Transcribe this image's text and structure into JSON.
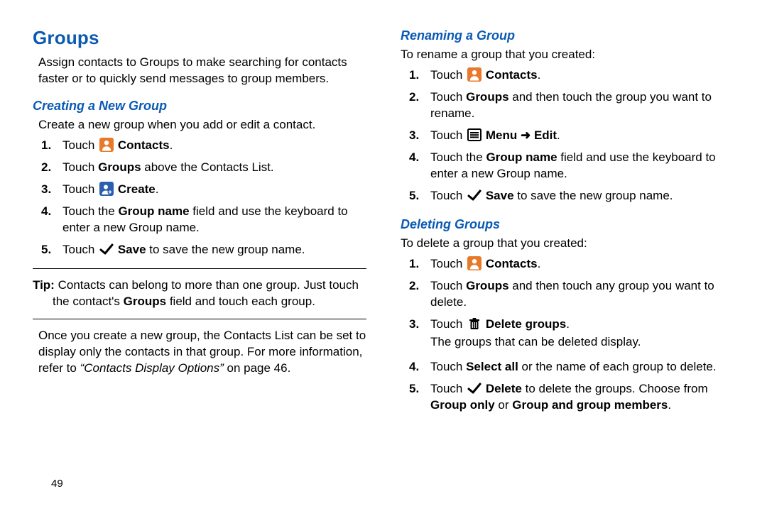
{
  "page_number": "49",
  "h1": "Groups",
  "intro": "Assign contacts to Groups to make searching for contacts faster or to quickly send messages to group members.",
  "creating": {
    "title": "Creating a New Group",
    "lead": "Create a new group when you add or edit a contact.",
    "s1_touch": "Touch",
    "s1_contacts": "Contacts",
    "s2_a": "Touch ",
    "s2_b": "Groups",
    "s2_c": " above the Contacts List.",
    "s3_touch": "Touch",
    "s3_create": "Create",
    "s4_a": "Touch the ",
    "s4_b": "Group name",
    "s4_c": " field and use the keyboard to enter a new Group name.",
    "s5_touch": "Touch",
    "s5_save": "Save",
    "s5_tail": " to save the new group name.",
    "tip_label": "Tip:",
    "tip_line1": " Contacts can belong to more than one group. Just touch",
    "tip_a": "the contact's ",
    "tip_b": "Groups",
    "tip_c": " field and touch each group.",
    "post_a": "Once you create a new group, the Contacts List can be set to display only the contacts in that group. For more information, refer to ",
    "post_ref": "“Contacts Display Options”",
    "post_b": " on page 46."
  },
  "renaming": {
    "title": "Renaming a Group",
    "lead": "To rename a group that you created:",
    "s1_touch": "Touch",
    "s1_contacts": "Contacts",
    "s2_a": "Touch ",
    "s2_b": "Groups",
    "s2_c": " and then touch the group you want to rename.",
    "s3_touch": "Touch",
    "s3_menu": "Menu",
    "s3_arrow": " ➜ ",
    "s3_edit": "Edit",
    "s4_a": "Touch the ",
    "s4_b": "Group name",
    "s4_c": " field and use the keyboard to enter a new Group name.",
    "s5_touch": "Touch",
    "s5_save": "Save",
    "s5_tail": " to save the new group name."
  },
  "deleting": {
    "title": "Deleting Groups",
    "lead": "To delete a group that you created:",
    "s1_touch": "Touch",
    "s1_contacts": "Contacts",
    "s2_a": "Touch ",
    "s2_b": "Groups",
    "s2_c": " and then touch any group you want to delete.",
    "s3_touch": "Touch",
    "s3_del": "Delete groups",
    "s3_sub": "The groups that can be deleted display.",
    "s4_a": "Touch ",
    "s4_b": "Select all",
    "s4_c": " or the name of each group to delete.",
    "s5_touch": "Touch",
    "s5_del": "Delete",
    "s5_mid": " to delete the groups. Choose from ",
    "s5_opt1": "Group only",
    "s5_or": " or ",
    "s5_opt2": "Group and group members",
    "s5_end": "."
  },
  "nums": {
    "n1": "1.",
    "n2": "2.",
    "n3": "3.",
    "n4": "4.",
    "n5": "5."
  },
  "period": "."
}
